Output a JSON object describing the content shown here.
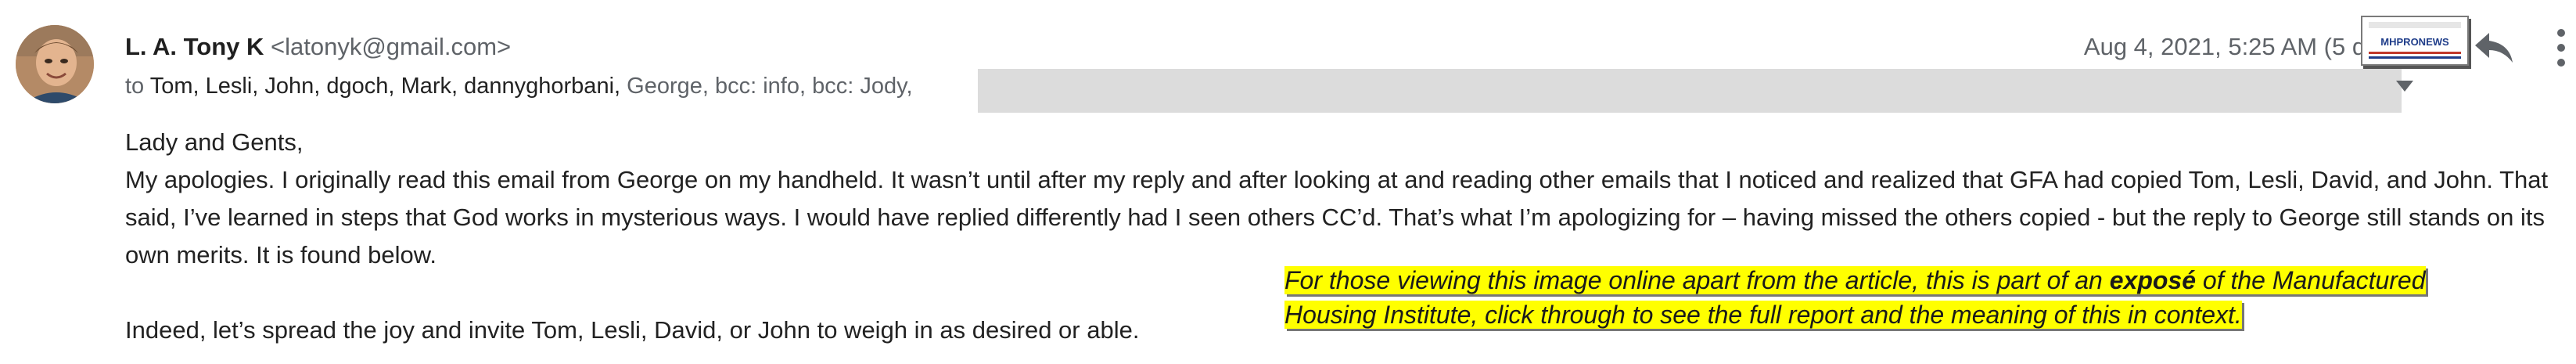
{
  "message": {
    "sender_name": "L. A. Tony K",
    "sender_email": "<latonyk@gmail.com>",
    "date": "Aug 4, 2021, 5:25 AM (5 days ago)",
    "recipients": {
      "to_prefix": "to",
      "names": [
        "Tom,",
        "Lesli,",
        "John,",
        "dgoch,",
        "Mark,",
        "dannyghorbani,"
      ],
      "others": "George, bcc: info, bcc: Jody,"
    },
    "body": {
      "greeting": "Lady and Gents,",
      "paragraph1": "My apologies. I originally read this email from George on my handheld. It wasn’t until after my reply and after looking at and reading other emails that I noticed and realized that GFA had copied Tom, Lesli, David, and John. That said, I’ve learned in steps that God works in mysterious ways. I would have replied differently had I seen others CC’d. That’s what I’m apologizing for – having missed the others copied - but the reply to George still stands on its own merits. It is found below.",
      "paragraph2": "Indeed, let’s spread the joy and invite Tom, Lesli, David, or John to weigh in as desired or able."
    }
  },
  "overlay": {
    "text_before": "For those viewing this image online apart from the article, this is part of an ",
    "text_bold": "exposé",
    "text_after_line1": " of the Manufactured",
    "text_line2": "Housing Institute, click through to see the full report and the meaning of this in context."
  },
  "logo": {
    "text": "MHPRONEWS"
  },
  "icons": {
    "reply": "reply-icon",
    "more": "more-vert-icon",
    "expand": "chevron-down-icon"
  },
  "colors": {
    "highlight": "#ffff00",
    "redaction": "#dcdcdc",
    "secondary_text": "#5f6368"
  }
}
